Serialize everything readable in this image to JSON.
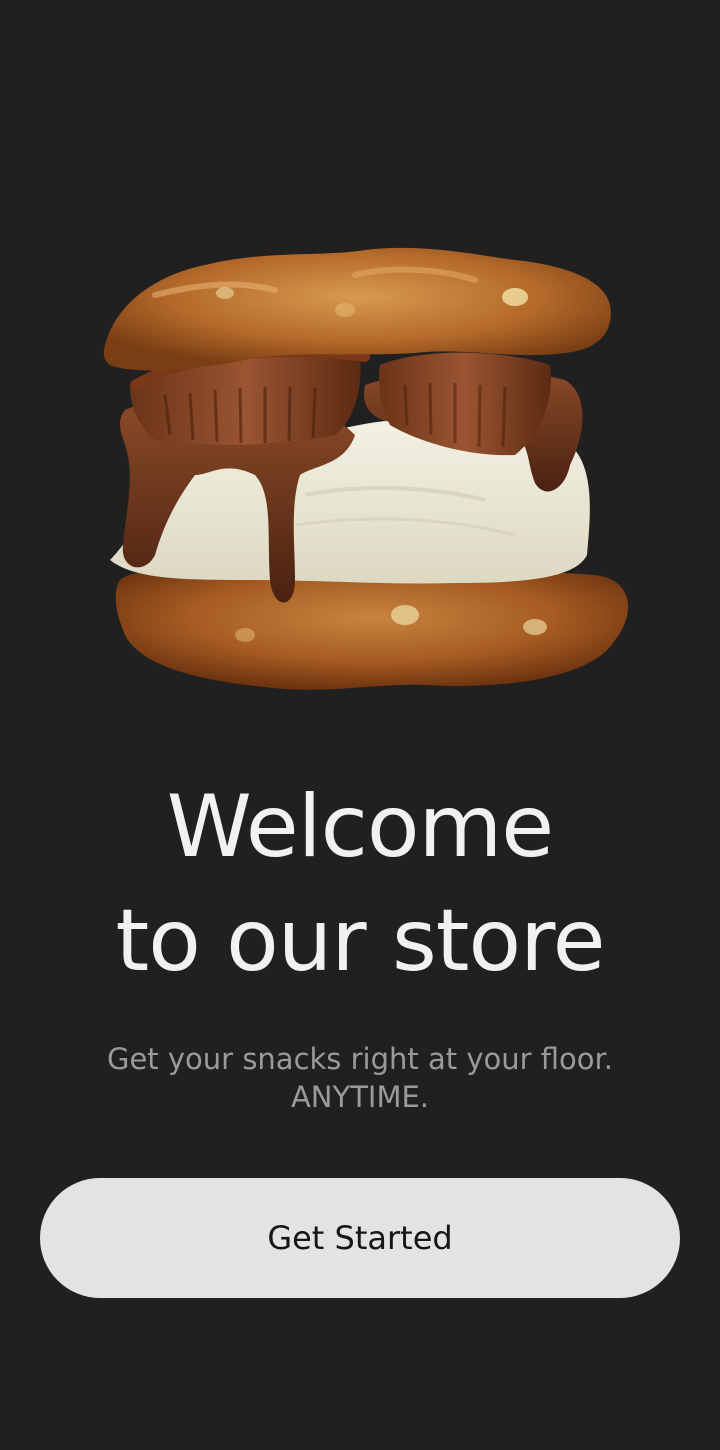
{
  "welcome": {
    "title_line1": "Welcome",
    "title_line2": "to our store",
    "subtitle_line1": "Get your snacks right at your floor.",
    "subtitle_line2": "ANYTIME.",
    "cta_label": "Get Started"
  },
  "hero": {
    "icon": "ice-cream-cookie-sandwich-image"
  },
  "colors": {
    "background": "#212020",
    "title": "#f1f1f1",
    "subtitle": "#9a9a9a",
    "button_bg": "#e3e3e3",
    "button_text": "#161616"
  }
}
